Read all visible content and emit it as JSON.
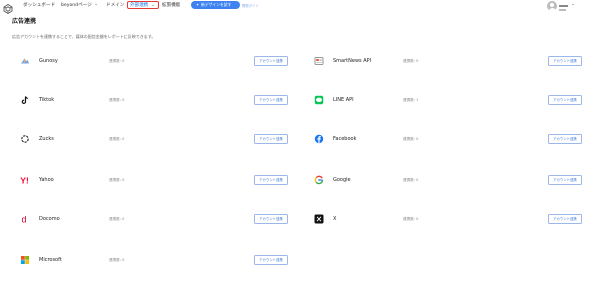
{
  "header": {
    "nav": [
      {
        "label": "ダッシュボード"
      },
      {
        "label": "beyondページ"
      },
      {
        "label": "ドメイン"
      },
      {
        "label": "外部連携"
      },
      {
        "label": "拡張機能"
      }
    ],
    "new_design_button": "新デザインを試す",
    "feedback_link": "開発ガイド"
  },
  "page": {
    "title": "広告連携",
    "description": "広告アカウントを連携することで、媒体の配信金額をレポートに反映できます。"
  },
  "connect_label": "アカウント連携",
  "integrations": [
    {
      "name": "Gunosy",
      "count": "連携数: 0",
      "icon": "gunosy-icon"
    },
    {
      "name": "SmartNews API",
      "count": "連携数: 0",
      "icon": "smartnews-icon"
    },
    {
      "name": "Tiktok",
      "count": "連携数: 0",
      "icon": "tiktok-icon"
    },
    {
      "name": "LINE API",
      "count": "連携数: 1",
      "icon": "line-icon"
    },
    {
      "name": "Zucks",
      "count": "連携数: 0",
      "icon": "zucks-icon"
    },
    {
      "name": "Facebook",
      "count": "連携数: 0",
      "icon": "facebook-icon"
    },
    {
      "name": "Yahoo",
      "count": "連携数: 0",
      "icon": "yahoo-icon"
    },
    {
      "name": "Google",
      "count": "連携数: 0",
      "icon": "google-icon"
    },
    {
      "name": "Docomo",
      "count": "連携数: 0",
      "icon": "docomo-icon"
    },
    {
      "name": "X",
      "count": "連携数: 0",
      "icon": "x-icon"
    },
    {
      "name": "Microsoft",
      "count": "連携数: 0",
      "icon": "microsoft-icon"
    }
  ],
  "colors": {
    "accent": "#3d82f0",
    "active_outline": "#e53935",
    "line_green": "#06c755",
    "facebook_blue": "#1877f2",
    "yahoo_red": "#ff0033",
    "docomo_red": "#cc0033"
  }
}
